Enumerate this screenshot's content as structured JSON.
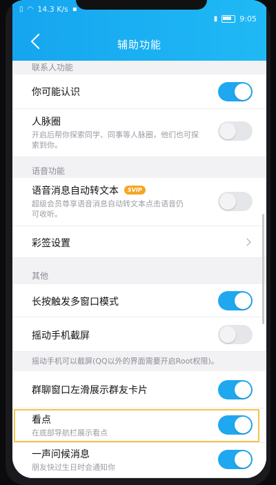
{
  "status": {
    "left_text": "14.3 K/s",
    "time": "9:05"
  },
  "header": {
    "title": "辅助功能"
  },
  "sections": {
    "contacts": "联系人功能",
    "voice": "语音功能",
    "other": "其他"
  },
  "rows": {
    "may_know": {
      "title": "你可能认识",
      "toggle": "on"
    },
    "network": {
      "title": "人脉圈",
      "desc": "开启后帮你探索同学、同事等人脉圈，他们也可探索到你。",
      "toggle": "off"
    },
    "voice_to_text": {
      "title": "语音消息自动转文本",
      "badge": "SVIP",
      "desc": "超级会员尊享语音消息自动转文本点击语音仍可收听。",
      "toggle": "off"
    },
    "color_sign": {
      "title": "彩签设置"
    },
    "long_press": {
      "title": "长按触发多窗口模式",
      "toggle": "on"
    },
    "shake_screenshot": {
      "title": "摇动手机截屏",
      "toggle": "off"
    },
    "shake_note": "摇动手机可以截屏(QQ以外的界面需要开启Root权限)。",
    "group_card": {
      "title": "群聊窗口左滑展示群友卡片",
      "toggle": "on"
    },
    "kandian": {
      "title": "看点",
      "desc": "在底部导航栏展示看点",
      "toggle": "on"
    },
    "greeting": {
      "title": "一声问候消息",
      "desc": "朋友快过生日时会通知你",
      "toggle": "on"
    }
  },
  "colors": {
    "accent": "#1fa8ef",
    "highlight": "#f5c24c",
    "badge": "#f5a623"
  }
}
